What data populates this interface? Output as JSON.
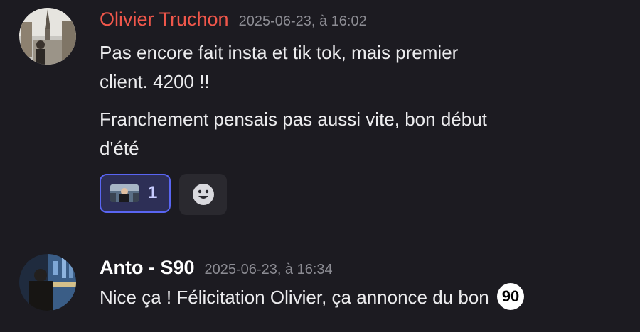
{
  "messages": [
    {
      "author": "Olivier Truchon",
      "author_color": "#f0574b",
      "timestamp": "2025-06-23, à 16:02",
      "lines": [
        "Pas encore fait insta et tik tok, mais premier",
        "client. 4200 !!",
        "Franchement pensais pas aussi vite, bon début",
        "d'été"
      ],
      "reactions": [
        {
          "emoji": "movie-scene-emoji",
          "count": "1"
        }
      ],
      "add_reaction_icon": "smiley-add-reaction-icon"
    },
    {
      "author": "Anto - S90",
      "author_color": "#ffffff",
      "timestamp": "2025-06-23, à 16:34",
      "text": "Nice ça ! Félicitation Olivier, ça annonce du bon",
      "badge": "90"
    }
  ]
}
